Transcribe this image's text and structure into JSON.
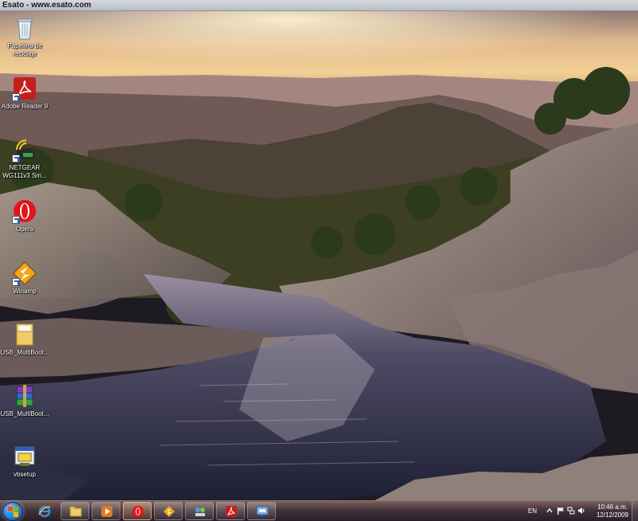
{
  "watermark": {
    "text": "Esato - www.esato.com"
  },
  "desktop": {
    "icons": [
      {
        "icon": "recycle-bin-icon",
        "label": "Papelera de reciclaje"
      },
      {
        "icon": "adobe-reader-icon",
        "label": "Adobe Reader 9"
      },
      {
        "icon": "netgear-icon",
        "label": "NETGEAR WG111v3 Sm..."
      },
      {
        "icon": "opera-icon",
        "label": "Opera"
      },
      {
        "icon": "winamp-icon",
        "label": "Winamp"
      },
      {
        "icon": "folder-icon",
        "label": "USB_MultiBoot..."
      },
      {
        "icon": "winrar-icon",
        "label": "USB_MultiBoot..."
      },
      {
        "icon": "vbsetup-icon",
        "label": "vbsetup"
      }
    ]
  },
  "taskbar": {
    "pinned": [
      {
        "icon": "internet-explorer-icon"
      },
      {
        "icon": "windows-explorer-icon"
      },
      {
        "icon": "media-player-icon"
      },
      {
        "icon": "opera-icon"
      },
      {
        "icon": "winamp-icon"
      },
      {
        "icon": "network-app-icon"
      },
      {
        "icon": "adobe-reader-icon"
      },
      {
        "icon": "network-monitor-icon"
      }
    ],
    "tray": {
      "language": "EN",
      "time": "10:46 a.m.",
      "date": "12/12/2009"
    }
  },
  "colors": {
    "taskbar": "#46343c",
    "sky": "#e8c18a",
    "water": "#3a3850"
  }
}
